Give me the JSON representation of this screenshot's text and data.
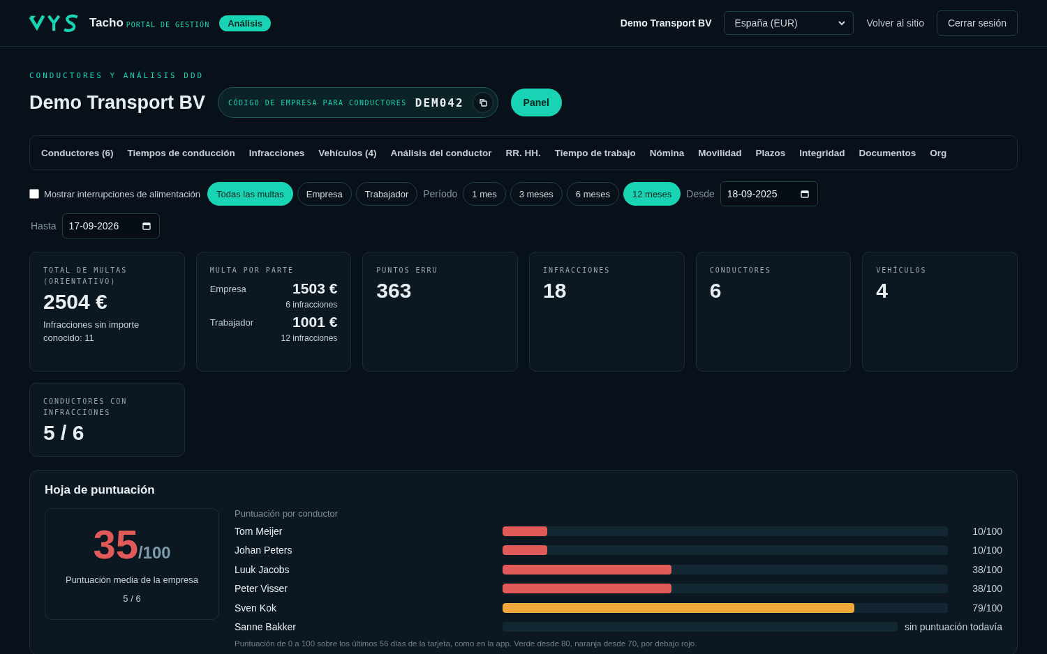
{
  "header": {
    "brand": "Tacho",
    "subtitle": "PORTAL DE GESTIÓN",
    "badge": "Análisis",
    "company": "Demo Transport BV",
    "region": "España (EUR)",
    "back_link": "Volver al sitio",
    "logout": "Cerrar sesión"
  },
  "page": {
    "eyebrow": "CONDUCTORES Y ANÁLISIS DDD",
    "title": "Demo Transport BV",
    "code_label": "CÓDIGO DE EMPRESA PARA CONDUCTORES",
    "code": "DEM042",
    "panel_button": "Panel"
  },
  "tabs": [
    {
      "label": "Conductores (6)",
      "selected": false
    },
    {
      "label": "Tiempos de conducción",
      "selected": false
    },
    {
      "label": "Infracciones",
      "selected": false
    },
    {
      "label": "Vehículos (4)",
      "selected": false
    },
    {
      "label": "Análisis del conductor",
      "selected": false
    },
    {
      "label": "RR. HH.",
      "selected": false
    },
    {
      "label": "Tiempo de trabajo",
      "selected": false
    },
    {
      "label": "Nómina",
      "selected": false
    },
    {
      "label": "Movilidad",
      "selected": false
    },
    {
      "label": "Plazos",
      "selected": false
    },
    {
      "label": "Integridad",
      "selected": false
    },
    {
      "label": "Documentos",
      "selected": false
    },
    {
      "label": "Org",
      "selected": false
    }
  ],
  "filters": {
    "power_checkbox": {
      "label": "Mostrar interrupciones de alimentación",
      "checked": false
    },
    "party": [
      {
        "label": "Todas las multas",
        "selected": true
      },
      {
        "label": "Empresa",
        "selected": false
      },
      {
        "label": "Trabajador",
        "selected": false
      }
    ],
    "period_label": "Período",
    "periods": [
      {
        "label": "1 mes",
        "selected": false
      },
      {
        "label": "3 meses",
        "selected": false
      },
      {
        "label": "6 meses",
        "selected": false
      },
      {
        "label": "12 meses",
        "selected": true
      }
    ],
    "from_label": "Desde",
    "from": "18-09-2025",
    "to_label": "Hasta",
    "to": "17-09-2026"
  },
  "stats": [
    {
      "kind": "note",
      "label": "TOTAL DE MULTAS (ORIENTATIVO)",
      "value": "2504 €",
      "note": "Infracciones sin importe conocido: 11"
    },
    {
      "kind": "split",
      "label": "MULTA POR PARTE",
      "parts": [
        {
          "name": "Empresa",
          "value": "1503 €",
          "count": "6 infracciones"
        },
        {
          "name": "Trabajador",
          "value": "1001 €",
          "count": "12 infracciones"
        }
      ]
    },
    {
      "kind": "simple",
      "label": "PUNTOS ERRU",
      "value": "363"
    },
    {
      "kind": "simple",
      "label": "INFRACCIONES",
      "value": "18"
    },
    {
      "kind": "simple",
      "label": "CONDUCTORES",
      "value": "6"
    },
    {
      "kind": "simple",
      "label": "VEHÍCULOS",
      "value": "4"
    },
    {
      "kind": "simple",
      "label": "CONDUCTORES CON INFRACCIONES",
      "value": "5 / 6"
    }
  ],
  "scorecard": {
    "title": "Hoja de puntuación",
    "average": "35",
    "out_of": "/100",
    "average_label": "Puntuación media de la empresa",
    "ratio": "5 / 6",
    "list_title": "Puntuación por conductor",
    "drivers": [
      {
        "kind": "scored",
        "name": "Tom Meijer",
        "level": 0.1,
        "color": "#e05a5a",
        "reading": "10/100"
      },
      {
        "kind": "scored",
        "name": "Johan Peters",
        "level": 0.1,
        "color": "#e05a5a",
        "reading": "10/100"
      },
      {
        "kind": "scored",
        "name": "Luuk Jacobs",
        "level": 0.38,
        "color": "#e05a5a",
        "reading": "38/100"
      },
      {
        "kind": "scored",
        "name": "Peter Visser",
        "level": 0.38,
        "color": "#e05a5a",
        "reading": "38/100"
      },
      {
        "kind": "scored",
        "name": "Sven Kok",
        "level": 0.79,
        "color": "#f0a83a",
        "reading": "79/100"
      },
      {
        "kind": "none",
        "name": "Sanne Bakker",
        "reading": "sin puntuación todavía"
      }
    ],
    "footnote": "Puntuación de 0 a 100 sobre los últimos 56 días de la tarjeta, como en la app. Verde desde 80, naranja desde 70, por debajo rojo."
  }
}
